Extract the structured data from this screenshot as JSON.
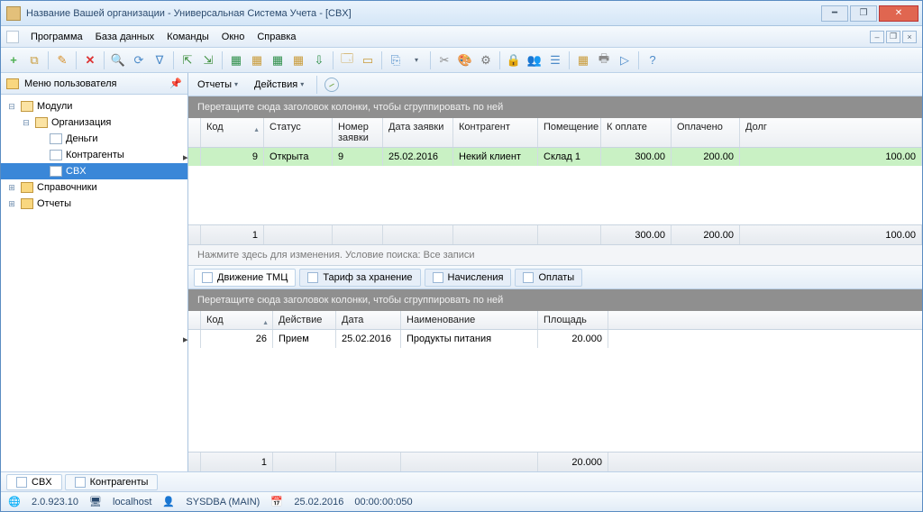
{
  "window": {
    "title": "Название Вашей организации - Универсальная Система Учета - [CBX]"
  },
  "menu": [
    "Программа",
    "База данных",
    "Команды",
    "Окно",
    "Справка"
  ],
  "sidebar": {
    "title": "Меню пользователя",
    "nodes": [
      {
        "l": 0,
        "exp": "−",
        "ico": "fldo",
        "t": "Модули"
      },
      {
        "l": 1,
        "exp": "−",
        "ico": "fldo",
        "t": "Организация"
      },
      {
        "l": 2,
        "exp": "",
        "ico": "doc",
        "t": "Деньги"
      },
      {
        "l": 2,
        "exp": "",
        "ico": "doc",
        "t": "Контрагенты"
      },
      {
        "l": 2,
        "exp": "",
        "ico": "doc",
        "t": "CBX",
        "sel": true
      },
      {
        "l": 0,
        "exp": "+",
        "ico": "fld",
        "t": "Справочники"
      },
      {
        "l": 0,
        "exp": "+",
        "ico": "fld",
        "t": "Отчеты"
      }
    ]
  },
  "mainbar": {
    "reports": "Отчеты",
    "actions": "Действия"
  },
  "group_hint": "Перетащите сюда заголовок колонки, чтобы сгруппировать по ней",
  "grid1": {
    "cols": [
      "Код",
      "Статус",
      "Номер заявки",
      "Дата заявки",
      "Контрагент",
      "Помещение",
      "К оплате",
      "Оплачено",
      "Долг"
    ],
    "row": {
      "code": "9",
      "status": "Открыта",
      "num": "9",
      "date": "25.02.2016",
      "kont": "Некий клиент",
      "pom": "Склад 1",
      "pay": "300.00",
      "paid": "200.00",
      "debt": "100.00"
    },
    "foot": {
      "count": "1",
      "pay": "300.00",
      "paid": "200.00",
      "debt": "100.00"
    }
  },
  "search_hint": "Нажмите здесь для изменения. Условие поиска: Все записи",
  "tabs": [
    "Движение ТМЦ",
    "Тариф за хранение",
    "Начисления",
    "Оплаты"
  ],
  "grid2": {
    "cols": [
      "Код",
      "Действие",
      "Дата",
      "Наименование",
      "Площадь"
    ],
    "row": {
      "code": "26",
      "act": "Прием",
      "date": "25.02.2016",
      "name": "Продукты питания",
      "area": "20.000"
    },
    "foot": {
      "count": "1",
      "area": "20.000"
    }
  },
  "btabs": [
    "CBX",
    "Контрагенты"
  ],
  "status": {
    "ver": "2.0.923.10",
    "host": "localhost",
    "user": "SYSDBA (MAIN)",
    "date": "25.02.2016",
    "time": "00:00:00:050"
  }
}
